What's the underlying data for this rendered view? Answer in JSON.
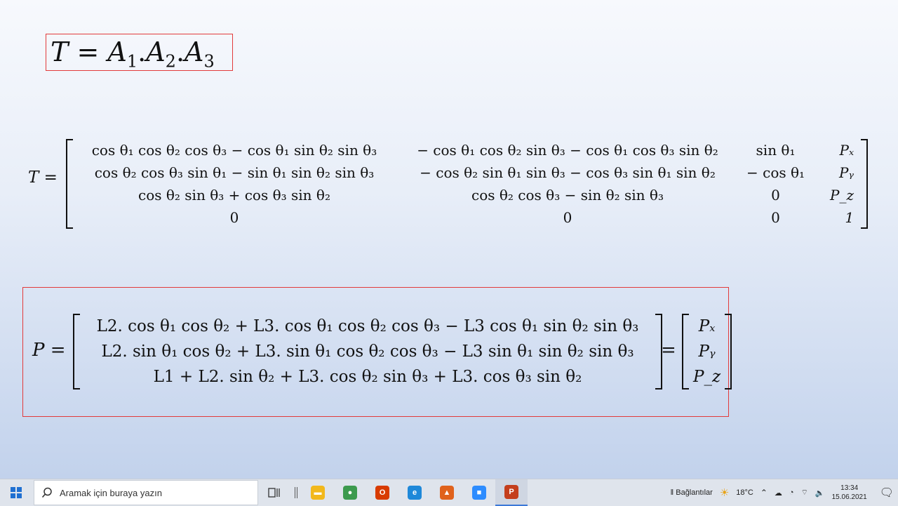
{
  "slide": {
    "formula_T": {
      "T": "T",
      "eq": "=",
      "A1": "A",
      "s1": "1",
      "A2": "A",
      "s2": "2",
      "A3": "A",
      "s3": "3"
    },
    "t_label": "T =",
    "t_matrix": [
      [
        "cos θ₁ cos θ₂ cos θ₃ − cos θ₁ sin θ₂ sin θ₃",
        "− cos θ₁ cos θ₂ sin θ₃ − cos θ₁ cos θ₃ sin θ₂",
        "sin θ₁",
        "Pₓ"
      ],
      [
        "cos θ₂ cos θ₃ sin θ₁ − sin θ₁ sin θ₂ sin θ₃",
        "− cos θ₂ sin θ₁ sin θ₃ − cos θ₃ sin θ₁ sin θ₂",
        "− cos θ₁",
        "Pᵧ"
      ],
      [
        "cos θ₂ sin θ₃ + cos θ₃ sin θ₂",
        "cos θ₂ cos θ₃ − sin θ₂ sin θ₃",
        "0",
        "P_z"
      ],
      [
        "0",
        "0",
        "0",
        "1"
      ]
    ],
    "p_label": "P =",
    "p_matrix": [
      "L2. cos θ₁ cos θ₂ + L3. cos θ₁ cos θ₂ cos θ₃ − L3 cos θ₁ sin θ₂ sin θ₃",
      "L2. sin θ₁ cos θ₂ + L3. sin θ₁ cos θ₂ cos θ₃ − L3 sin θ₁ sin θ₂ sin θ₃",
      "L1 + L2. sin θ₂ + L3. cos θ₂ sin θ₃ + L3. cos θ₃ sin θ₂"
    ],
    "p_eq": "=",
    "p_vector": [
      "Pₓ",
      "Pᵧ",
      "P_z"
    ]
  },
  "taskbar": {
    "search_placeholder": "Aramak için buraya yazın",
    "apps": [
      {
        "name": "file-explorer",
        "color": "#f2b81c"
      },
      {
        "name": "chrome",
        "color": "#3c9a4e"
      },
      {
        "name": "office",
        "color": "#d83b01"
      },
      {
        "name": "edge",
        "color": "#1e88d9"
      },
      {
        "name": "matlab",
        "color": "#e0621c"
      },
      {
        "name": "zoom",
        "color": "#2d8cff"
      },
      {
        "name": "powerpoint",
        "color": "#c43e1c"
      }
    ],
    "links_label": "Bağlantılar",
    "temperature": "18°C",
    "time": "13:34",
    "date": "15.06.2021"
  }
}
